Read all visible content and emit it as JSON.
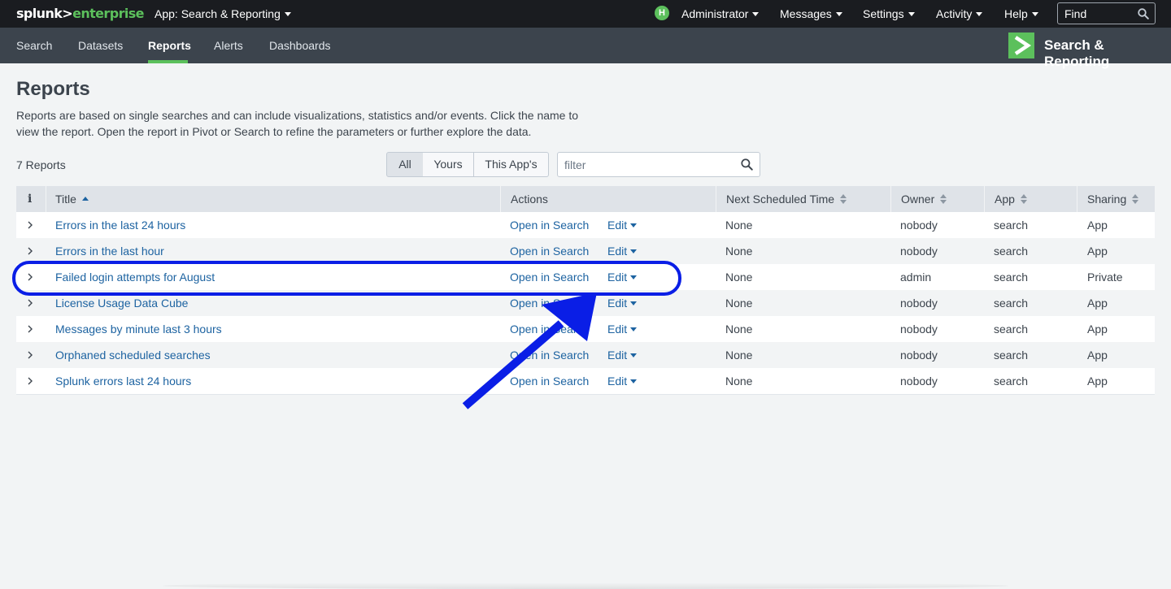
{
  "topbar": {
    "logo_part1": "splunk>",
    "logo_part2": "enterprise",
    "app_menu": "App: Search & Reporting",
    "user_initial": "H",
    "user": "Administrator",
    "messages": "Messages",
    "settings": "Settings",
    "activity": "Activity",
    "help": "Help",
    "find_placeholder": "Find"
  },
  "appbar": {
    "tabs": [
      {
        "label": "Search"
      },
      {
        "label": "Datasets"
      },
      {
        "label": "Reports"
      },
      {
        "label": "Alerts"
      },
      {
        "label": "Dashboards"
      }
    ],
    "active_tab": "Reports",
    "app_name": "Search & Reporting"
  },
  "page": {
    "title": "Reports",
    "description_line1": "Reports are based on single searches and can include visualizations, statistics and/or events. Click the name to",
    "description_line2": "view the report. Open the report in Pivot or Search to refine the parameters or further explore the data.",
    "count": "7 Reports",
    "filters": [
      "All",
      "Yours",
      "This App's"
    ],
    "active_filter": "All",
    "filter_placeholder": "filter"
  },
  "table": {
    "columns": {
      "info": "i",
      "title": "Title",
      "actions": "Actions",
      "next_scheduled": "Next Scheduled Time",
      "owner": "Owner",
      "app": "App",
      "sharing": "Sharing"
    },
    "rows": [
      {
        "title": "Errors in the last 24 hours",
        "open": "Open in Search",
        "edit": "Edit",
        "next": "None",
        "owner": "nobody",
        "app": "search",
        "sharing": "App"
      },
      {
        "title": "Errors in the last hour",
        "open": "Open in Search",
        "edit": "Edit",
        "next": "None",
        "owner": "nobody",
        "app": "search",
        "sharing": "App"
      },
      {
        "title": "Failed login attempts for August",
        "open": "Open in Search",
        "edit": "Edit",
        "next": "None",
        "owner": "admin",
        "app": "search",
        "sharing": "Private"
      },
      {
        "title": "License Usage Data Cube",
        "open": "Open in Search",
        "edit": "Edit",
        "next": "None",
        "owner": "nobody",
        "app": "search",
        "sharing": "App"
      },
      {
        "title": "Messages by minute last 3 hours",
        "open": "Open in Search",
        "edit": "Edit",
        "next": "None",
        "owner": "nobody",
        "app": "search",
        "sharing": "App"
      },
      {
        "title": "Orphaned scheduled searches",
        "open": "Open in Search",
        "edit": "Edit",
        "next": "None",
        "owner": "nobody",
        "app": "search",
        "sharing": "App"
      },
      {
        "title": "Splunk errors last 24 hours",
        "open": "Open in Search",
        "edit": "Edit",
        "next": "None",
        "owner": "nobody",
        "app": "search",
        "sharing": "App"
      }
    ]
  },
  "annotation": {
    "color": "#0a1ee6",
    "highlighted_row": "Failed login attempts for August"
  },
  "colors": {
    "topbar_bg": "#1a1c20",
    "appbar_bg": "#3c444d",
    "accent_green": "#5cc05c",
    "link_blue": "#1d63a1"
  }
}
